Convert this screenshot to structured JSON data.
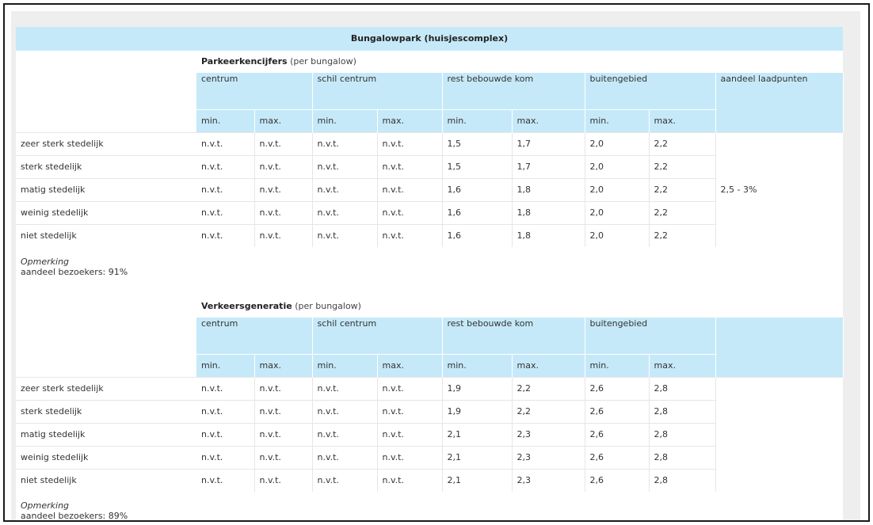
{
  "title": "Bungalowpark (huisjescomplex)",
  "column_headers": {
    "centrum": "centrum",
    "schil_centrum": "schil centrum",
    "rest_bebouwde_kom": "rest bebouwde kom",
    "buitengebied": "buitengebied",
    "aandeel_laadpunten": "aandeel laadpunten",
    "min": "min.",
    "max": "max."
  },
  "parkeer": {
    "title": "Parkeerkencijfers",
    "subtitle": "(per bungalow)",
    "share": "2,5 - 3%",
    "rows": [
      {
        "label": "zeer sterk stedelijk",
        "values": [
          "n.v.t.",
          "n.v.t.",
          "n.v.t.",
          "n.v.t.",
          "1,5",
          "1,7",
          "2,0",
          "2,2"
        ]
      },
      {
        "label": "sterk stedelijk",
        "values": [
          "n.v.t.",
          "n.v.t.",
          "n.v.t.",
          "n.v.t.",
          "1,5",
          "1,7",
          "2,0",
          "2,2"
        ]
      },
      {
        "label": "matig stedelijk",
        "values": [
          "n.v.t.",
          "n.v.t.",
          "n.v.t.",
          "n.v.t.",
          "1,6",
          "1,8",
          "2,0",
          "2,2"
        ]
      },
      {
        "label": "weinig stedelijk",
        "values": [
          "n.v.t.",
          "n.v.t.",
          "n.v.t.",
          "n.v.t.",
          "1,6",
          "1,8",
          "2,0",
          "2,2"
        ]
      },
      {
        "label": "niet stedelijk",
        "values": [
          "n.v.t.",
          "n.v.t.",
          "n.v.t.",
          "n.v.t.",
          "1,6",
          "1,8",
          "2,0",
          "2,2"
        ]
      }
    ],
    "remark_title": "Opmerking",
    "remark_text": "aandeel bezoekers: 91%"
  },
  "verkeer": {
    "title": "Verkeersgeneratie",
    "subtitle": "(per bungalow)",
    "rows": [
      {
        "label": "zeer sterk stedelijk",
        "values": [
          "n.v.t.",
          "n.v.t.",
          "n.v.t.",
          "n.v.t.",
          "1,9",
          "2,2",
          "2,6",
          "2,8"
        ]
      },
      {
        "label": "sterk stedelijk",
        "values": [
          "n.v.t.",
          "n.v.t.",
          "n.v.t.",
          "n.v.t.",
          "1,9",
          "2,2",
          "2,6",
          "2,8"
        ]
      },
      {
        "label": "matig stedelijk",
        "values": [
          "n.v.t.",
          "n.v.t.",
          "n.v.t.",
          "n.v.t.",
          "2,1",
          "2,3",
          "2,6",
          "2,8"
        ]
      },
      {
        "label": "weinig stedelijk",
        "values": [
          "n.v.t.",
          "n.v.t.",
          "n.v.t.",
          "n.v.t.",
          "2,1",
          "2,3",
          "2,6",
          "2,8"
        ]
      },
      {
        "label": "niet stedelijk",
        "values": [
          "n.v.t.",
          "n.v.t.",
          "n.v.t.",
          "n.v.t.",
          "2,1",
          "2,3",
          "2,6",
          "2,8"
        ]
      }
    ],
    "remark_title": "Opmerking",
    "remark_text": "aandeel bezoekers: 89%"
  },
  "colors": {
    "header_blue": "#c6e9f9",
    "page_gray": "#eeeeee"
  }
}
